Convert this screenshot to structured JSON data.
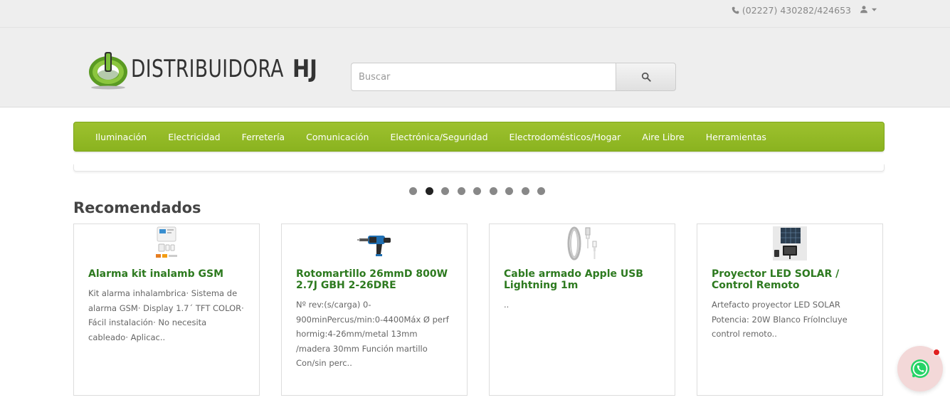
{
  "topbar": {
    "phone": "(02227) 430282/424653",
    "phone_icon": "phone-icon",
    "account_icon": "user-icon"
  },
  "header": {
    "logo_word": "DISTRIBUIDORA",
    "logo_hj": "HJ",
    "search_placeholder": "Buscar",
    "search_value": ""
  },
  "menu": {
    "items": [
      {
        "label": "Iluminación"
      },
      {
        "label": "Electricidad"
      },
      {
        "label": "Ferretería"
      },
      {
        "label": "Comunicación"
      },
      {
        "label": "Electrónica/Seguridad"
      },
      {
        "label": "Electrodomésticos/Hogar"
      },
      {
        "label": "Aire Libre"
      },
      {
        "label": "Herramientas"
      }
    ]
  },
  "slider": {
    "dot_count": 9,
    "active_index": 1
  },
  "recommended": {
    "title": "Recomendados",
    "products": [
      {
        "name": "Alarma kit inalamb GSM",
        "description": "Kit alarma inhalambrica· Sistema de alarma GSM· Display 1.7´ TFT COLOR· Fácil instalación· No necesita cableado· Aplicac..",
        "image_icon": "alarm-kit-image"
      },
      {
        "name": "Rotomartillo 26mmD 800W 2.7J GBH 2-26DRE",
        "description": "Nº rev:(s/carga) 0-900minPercus/min:0-4400Máx Ø perf hormig:4-26mm/metal 13mm /madera 30mm Función martillo Con/sin perc..",
        "image_icon": "rotary-hammer-image"
      },
      {
        "name": "Cable armado Apple USB Lightning 1m",
        "description": "..",
        "image_icon": "usb-cable-image"
      },
      {
        "name": "Proyector LED SOLAR / Control Remoto",
        "description": "Artefacto proyector LED SOLAR Potencia: 20W Blanco FríoIncluye control remoto..",
        "image_icon": "solar-led-projector-image"
      }
    ]
  },
  "colors": {
    "menu_green": "#8ab31f",
    "product_title": "#2d7a1f",
    "whatsapp_green": "#25d366",
    "notification_red": "#e02020"
  }
}
